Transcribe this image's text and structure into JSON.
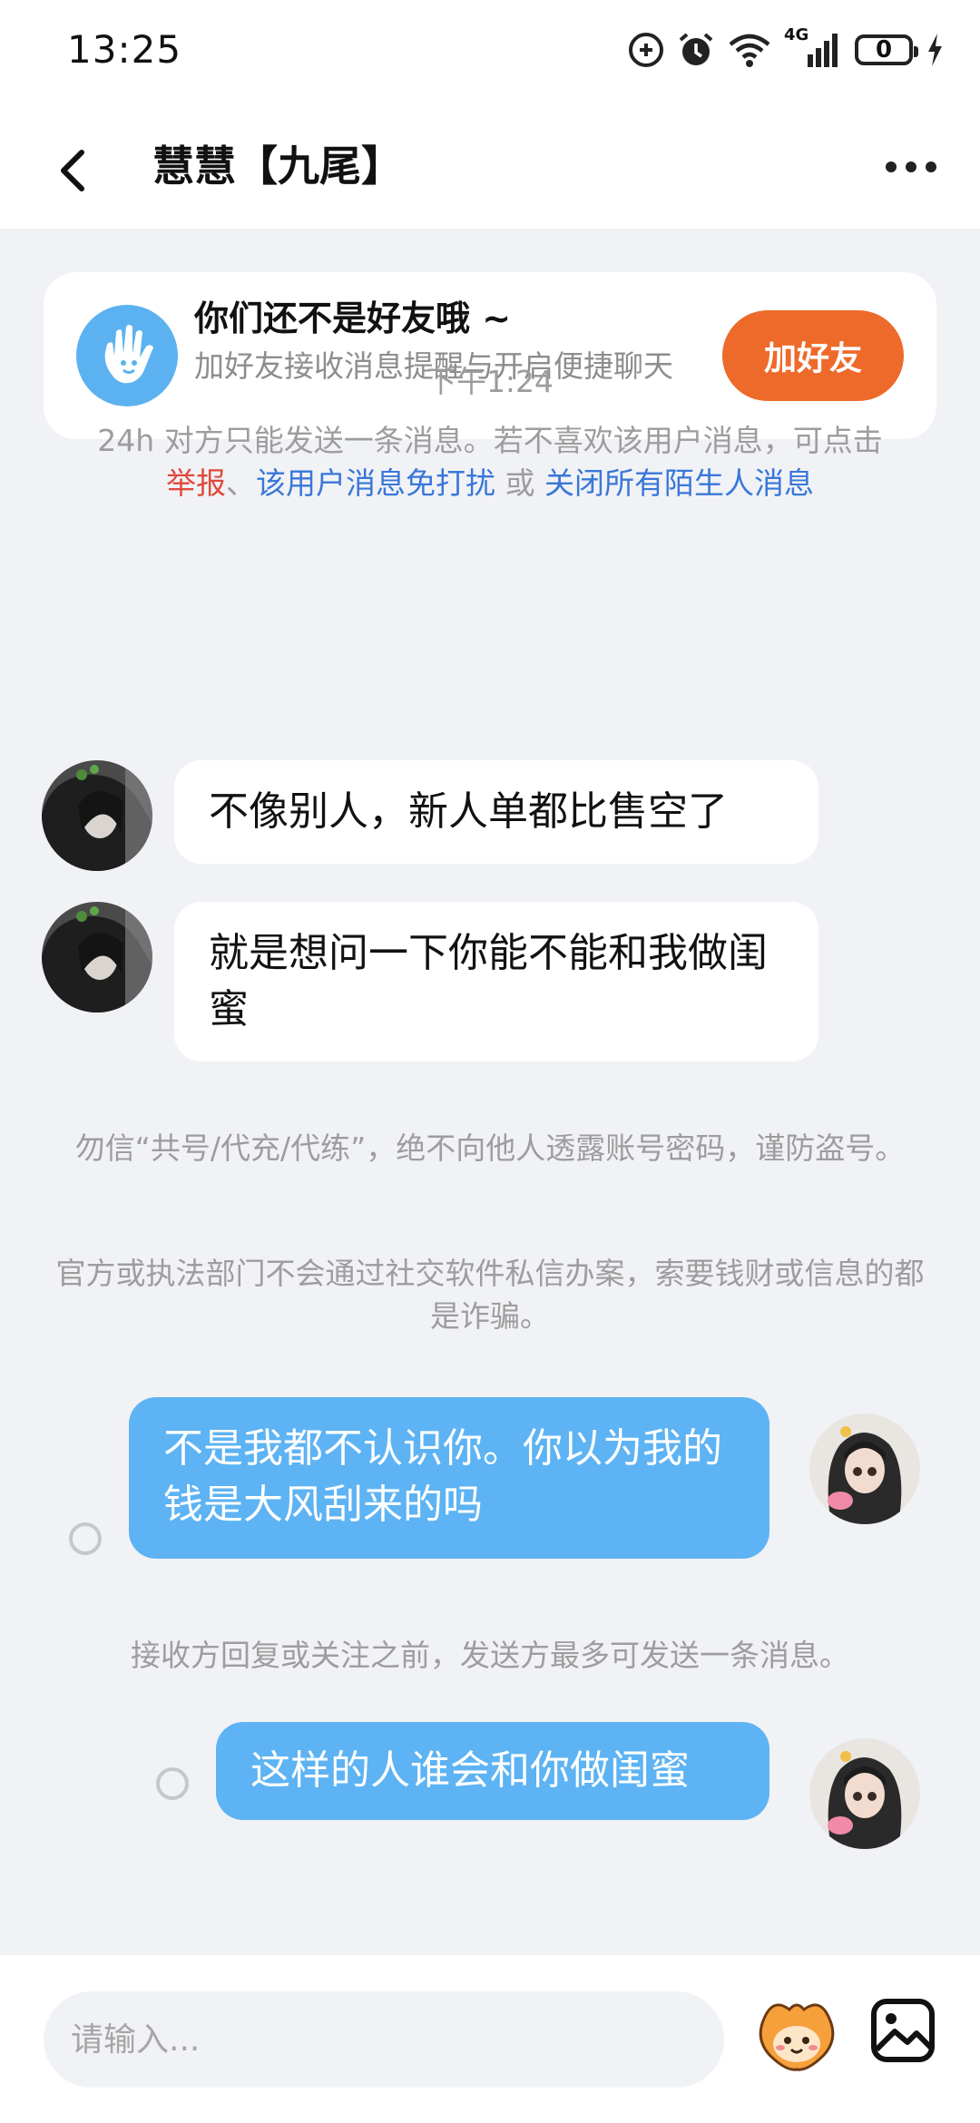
{
  "status_bar": {
    "time": "13:25",
    "network": "4G",
    "battery_level": "0",
    "icons": [
      "data-saver-icon",
      "alarm-icon",
      "wifi-icon",
      "signal-icon",
      "battery-icon",
      "charging-icon"
    ]
  },
  "header": {
    "title": "慧慧【九尾】",
    "back_icon": "chevron-left-icon",
    "more_icon": "more-horizontal-icon"
  },
  "friend_card": {
    "title": "你们还不是好友哦 ~",
    "subtitle": "加好友接收消息提醒与开启便捷聊天",
    "button_label": "加好友",
    "icon": "hand-wave-icon",
    "icon_color": "#5cb2f0",
    "button_color": "#ee6a2a"
  },
  "chat": {
    "timestamp": "下午1:24",
    "limit_notice": {
      "text": "24h 对方只能发送一条消息。若不喜欢该用户消息，可点击",
      "link_report": "举报",
      "sep1": "、",
      "link_mute_user": "该用户消息免打扰",
      "sep2": " 或 ",
      "link_close_strangers": "关闭所有陌生人消息"
    },
    "incoming": [
      {
        "text": "不像别人，新人单都比售空了"
      },
      {
        "text": "就是想问一下你能不能和我做闺蜜"
      }
    ],
    "safety_notice_1": "勿信“共号/代充/代练”，绝不向他人透露账号密码，谨防盗号。",
    "safety_notice_2": "官方或执法部门不会通过社交软件私信办案，索要钱财或信息的都是诈骗。",
    "outgoing": [
      {
        "text": "不是我都不认识你。你以为我的钱是大风刮来的吗"
      },
      {
        "text": "这样的人谁会和你做闺蜜"
      }
    ],
    "send_limit_notice": "接收方回复或关注之前，发送方最多可发送一条消息。",
    "outgoing_bubble_color": "#5db3f3"
  },
  "input_bar": {
    "placeholder": "请输入...",
    "emoji_icon": "mascot-emoji-icon",
    "image_icon": "image-icon"
  }
}
